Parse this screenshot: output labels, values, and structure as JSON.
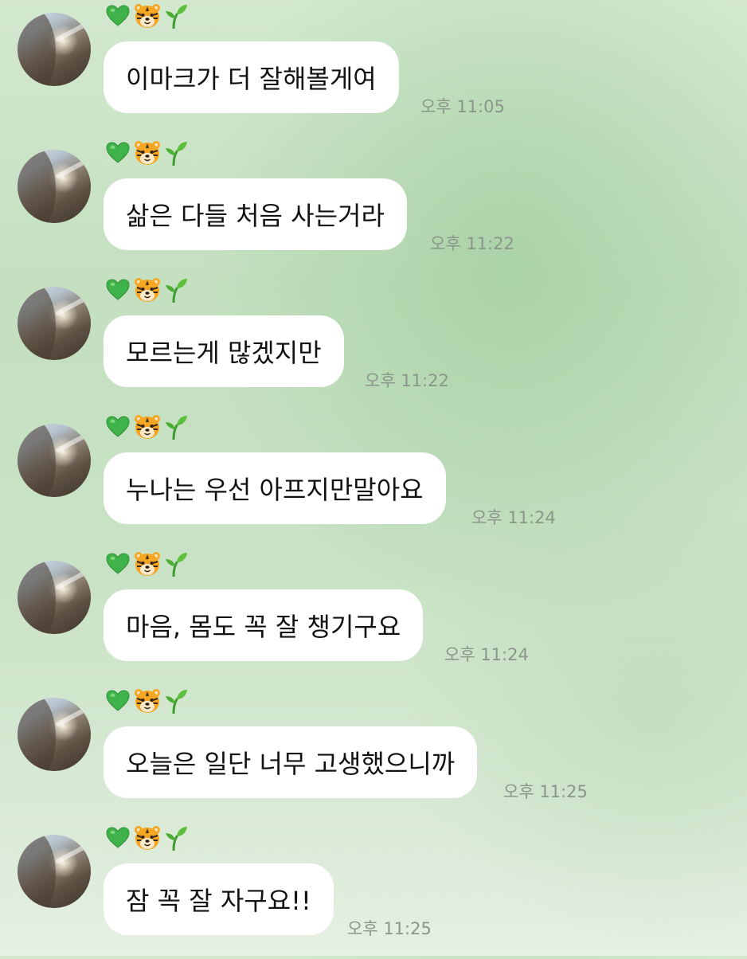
{
  "sender": {
    "icons": [
      "green-heart-icon",
      "tiger-face-icon",
      "seedling-icon"
    ],
    "avatar": "profile-photo"
  },
  "messages": [
    {
      "text": "이마크가 더 잘해볼게여",
      "time": "오후 11:05"
    },
    {
      "text": "삶은 다들 처음 사는거라",
      "time": "오후 11:22"
    },
    {
      "text": "모르는게 많겠지만",
      "time": "오후 11:22"
    },
    {
      "text": "누나는 우선 아프지만말아요",
      "time": "오후 11:24"
    },
    {
      "text": "마음, 몸도 꼭 잘 챙기구요",
      "time": "오후 11:24"
    },
    {
      "text": "오늘은 일단 너무 고생했으니까",
      "time": "오후 11:25"
    },
    {
      "text": "잠 꼭 잘 자구요!!",
      "time": "오후 11:25"
    }
  ],
  "colors": {
    "bubble": "#ffffff",
    "background": "#c8e1c4",
    "timestamp": "#8b968b",
    "text": "#121212"
  }
}
